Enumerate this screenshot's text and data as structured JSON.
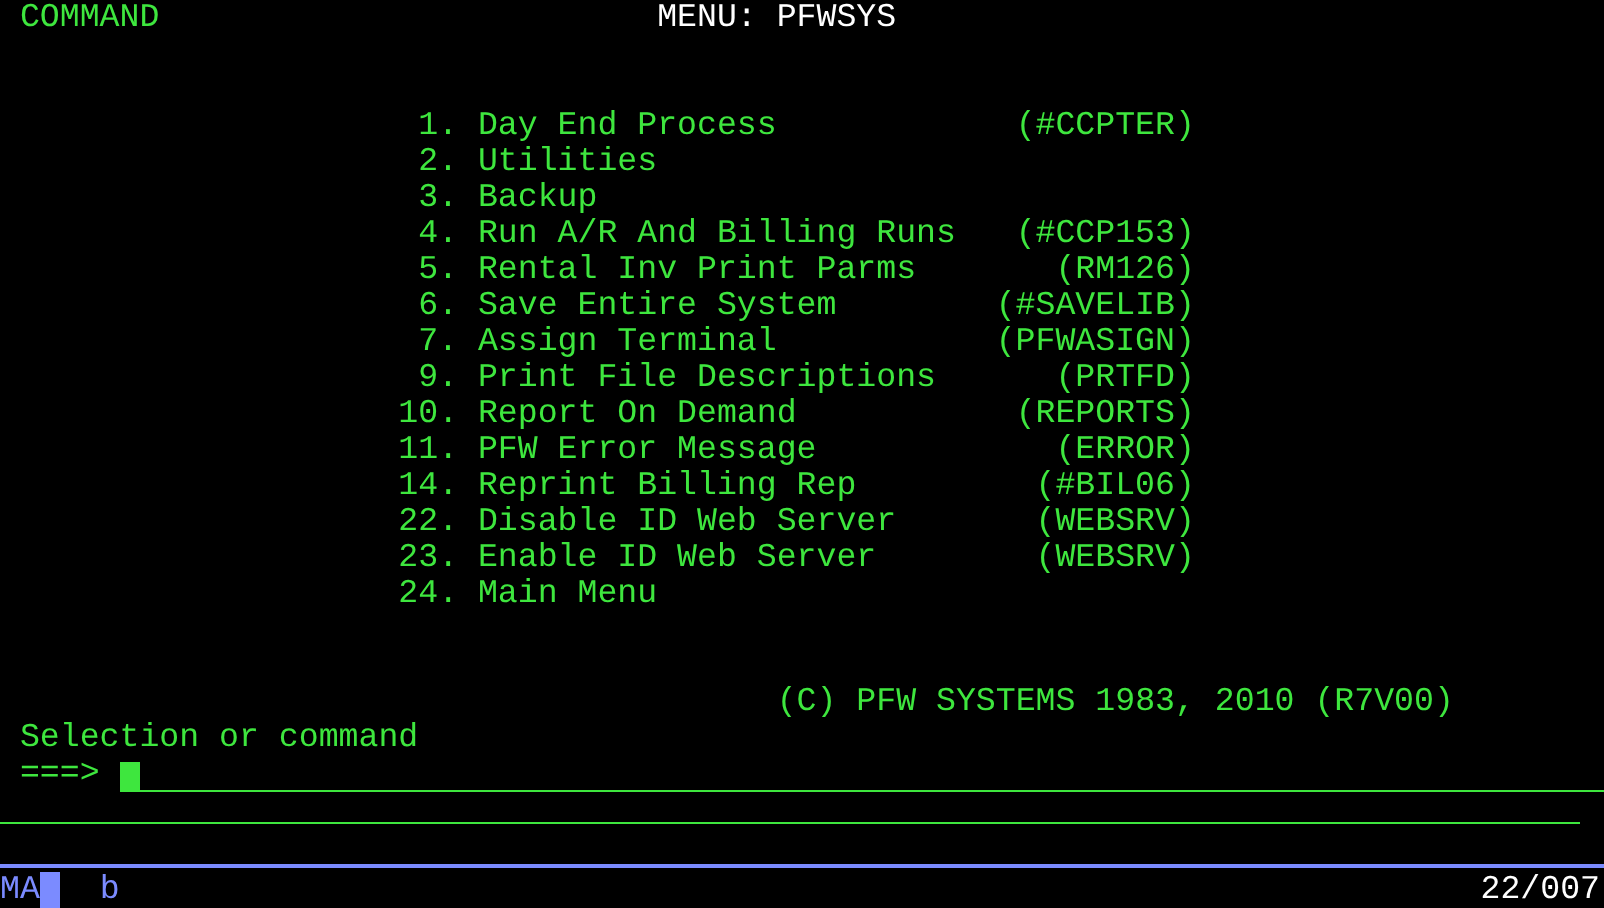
{
  "header": {
    "mode": "COMMAND",
    "title": "MENU: PFWSYS"
  },
  "menu_items": [
    {
      "number": "1.",
      "label": "Day End Process",
      "code": "(#CCPTER)"
    },
    {
      "number": "2.",
      "label": "Utilities"
    },
    {
      "number": "3.",
      "label": "Backup"
    },
    {
      "number": "4.",
      "label": "Run A/R And Billing Runs",
      "code": "(#CCP153)"
    },
    {
      "number": "5.",
      "label": "Rental Inv Print Parms",
      "code": "(RM126)"
    },
    {
      "number": "6.",
      "label": "Save Entire System",
      "code": "(#SAVELIB)"
    },
    {
      "number": "7.",
      "label": "Assign Terminal",
      "code": "(PFWASIGN)"
    },
    {
      "number": "9.",
      "label": "Print File Descriptions",
      "code": "(PRTFD)"
    },
    {
      "number": "10.",
      "label": "Report On Demand",
      "code": "(REPORTS)"
    },
    {
      "number": "11.",
      "label": "PFW Error Message",
      "code": "(ERROR)"
    },
    {
      "number": "14.",
      "label": "Reprint Billing Rep",
      "code": "(#BIL06)"
    },
    {
      "number": "22.",
      "label": "Disable ID Web Server",
      "code": "(WEBSRV)"
    },
    {
      "number": "23.",
      "label": "Enable ID Web Server",
      "code": "(WEBSRV)"
    },
    {
      "number": "24.",
      "label": "Main Menu"
    }
  ],
  "copyright": "(C) PFW SYSTEMS 1983, 2010 (R7V00)",
  "prompt": {
    "label": "Selection or command",
    "arrow": "===>"
  },
  "status_bar": {
    "session": "MA",
    "indicator": "b",
    "position": "22/007"
  }
}
